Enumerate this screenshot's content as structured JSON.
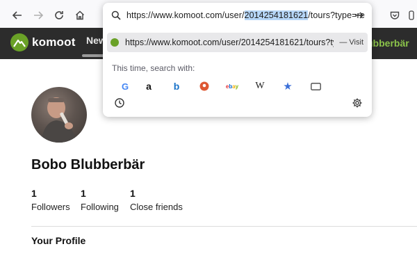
{
  "browser": {
    "url_prefix": "https://www.komoot.com/user/",
    "url_highlight": "2014254181621",
    "url_suffix": "/tours?type=re",
    "suggestion": {
      "url_main": "https://www.komoot.com/user/2014254181621/tours?typ",
      "url_fade": "e",
      "action": "— Visit"
    },
    "search_with_label": "This time, search with:",
    "engines": [
      {
        "name": "google",
        "glyph": "G",
        "color": "#4285f4"
      },
      {
        "name": "amazon",
        "glyph": "a",
        "color": "#111111"
      },
      {
        "name": "bing",
        "glyph": "b",
        "color": "#1a73c9"
      },
      {
        "name": "duckduckgo",
        "glyph": "◉",
        "color": "#de5833"
      },
      {
        "name": "ebay",
        "glyph": "ebay",
        "color": "#e53238"
      },
      {
        "name": "wikipedia",
        "glyph": "W",
        "color": "#222222"
      },
      {
        "name": "bookmarks",
        "glyph": "★",
        "color": "#3a6fd8"
      },
      {
        "name": "tabs",
        "glyph": "▭",
        "color": "#444444"
      }
    ]
  },
  "site": {
    "brand": "komoot",
    "brand_color": "#6aa127",
    "nav_partial": "New",
    "user_partial": "ubberbär"
  },
  "profile": {
    "name": "Bobo Blubberbär",
    "stats": [
      {
        "count": "1",
        "label": "Followers"
      },
      {
        "count": "1",
        "label": "Following"
      },
      {
        "count": "1",
        "label": "Close friends"
      }
    ],
    "section_title": "Your Profile"
  }
}
